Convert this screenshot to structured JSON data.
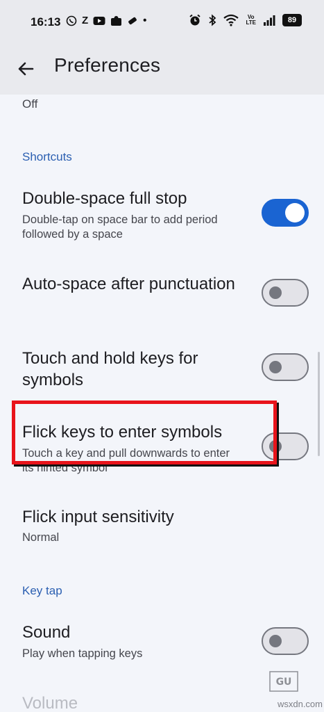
{
  "status_bar": {
    "time": "16:13",
    "left_icons": [
      "whatsapp-icon",
      "z-icon",
      "youtube-icon",
      "app-icon",
      "pass-icon",
      "dot-icon"
    ],
    "battery": "89",
    "volte": "Vo\nLTE"
  },
  "app_bar": {
    "title": "Preferences"
  },
  "content": {
    "previous_value": "Off",
    "sections": {
      "shortcuts": "Shortcuts",
      "key_tap": "Key tap"
    },
    "items": [
      {
        "title": "Double-space full stop",
        "subtitle": "Double-tap on space bar to add period followed by a space",
        "toggle": true
      },
      {
        "title": "Auto-space after punctuation",
        "subtitle": "",
        "toggle": false
      },
      {
        "title": "Touch and hold keys for symbols",
        "subtitle": "",
        "toggle": false
      },
      {
        "title": "Flick keys to enter symbols",
        "subtitle": "Touch a key and pull downwards to enter its hinted symbol",
        "toggle": false
      },
      {
        "title": "Flick input sensitivity",
        "subtitle": "Normal"
      },
      {
        "title": "Sound",
        "subtitle": "Play when tapping keys",
        "toggle": false
      },
      {
        "title": "Volume"
      }
    ]
  },
  "watermark": {
    "caption": "wsxdn.com"
  },
  "colors": {
    "accent": "#1a64d2",
    "section_header": "#2b5fb1",
    "highlight": "#e8141b"
  }
}
